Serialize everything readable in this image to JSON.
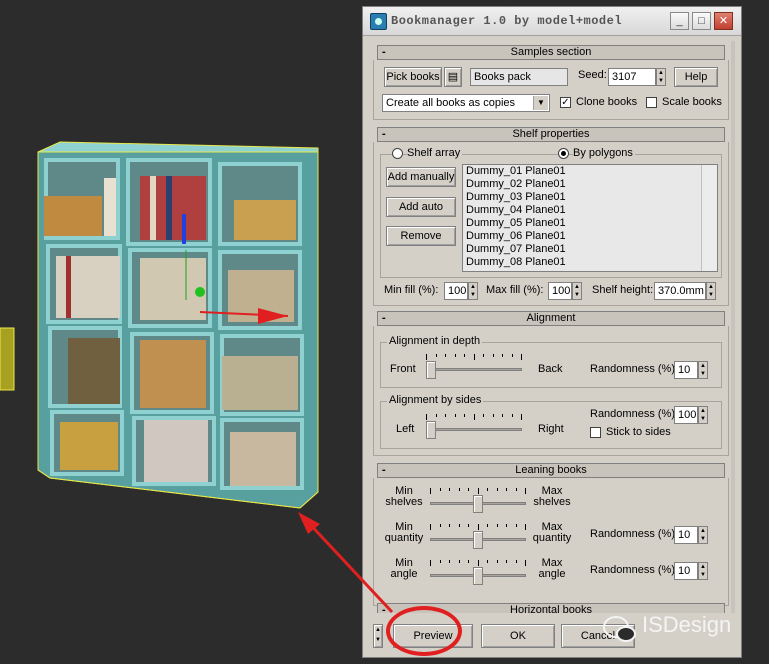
{
  "window": {
    "title": "Bookmanager 1.0 by model+model",
    "minimize_glyph": "_",
    "maximize_glyph": "□",
    "close_glyph": "✕"
  },
  "samples": {
    "header": "Samples section",
    "collapse": "-",
    "pick_books": "Pick books",
    "books_pack": "Books pack",
    "seed_label": "Seed:",
    "seed_value": "3107",
    "help": "Help",
    "mode": "Create all books as copies",
    "clone_books": "Clone books",
    "scale_books": "Scale books"
  },
  "shelf": {
    "header": "Shelf properties",
    "collapse": "-",
    "shelf_array": "Shelf array",
    "by_polygons": "By polygons",
    "add_manually": "Add manually",
    "add_auto": "Add auto",
    "remove": "Remove",
    "items": [
      "Dummy_01 Plane01",
      "Dummy_02 Plane01",
      "Dummy_03 Plane01",
      "Dummy_04 Plane01",
      "Dummy_05 Plane01",
      "Dummy_06 Plane01",
      "Dummy_07 Plane01",
      "Dummy_08 Plane01"
    ],
    "min_fill_label": "Min fill (%):",
    "min_fill_value": "100",
    "max_fill_label": "Max fill (%):",
    "max_fill_value": "100",
    "shelf_height_label": "Shelf height:",
    "shelf_height_value": "370.0mm"
  },
  "alignment": {
    "header": "Alignment",
    "collapse": "-",
    "depth_group": "Alignment in depth",
    "front": "Front",
    "back": "Back",
    "randomness_label": "Randomness (%):",
    "depth_randomness": "10",
    "sides_group": "Alignment by sides",
    "left": "Left",
    "right": "Right",
    "sides_randomness": "100",
    "stick_to_sides": "Stick to sides",
    "depth_slider_level": 0.0,
    "sides_slider_level": 0.0
  },
  "leaning": {
    "header": "Leaning books",
    "collapse": "-",
    "min_shelves": "Min shelves",
    "max_shelves": "Max shelves",
    "min_quantity": "Min quantity",
    "max_quantity": "Max quantity",
    "min_angle": "Min angle",
    "max_angle": "Max angle",
    "randomness_label": "Randomness (%):",
    "quantity_randomness": "10",
    "angle_randomness": "10",
    "shelves_level": 0.5,
    "quantity_level": 0.5,
    "angle_level": 0.5
  },
  "horizontal": {
    "header": "Horizontal books",
    "collapse": "-"
  },
  "footer": {
    "preview": "Preview",
    "ok": "OK",
    "cancel": "Cancel"
  },
  "watermark": {
    "text": "ISDesign"
  },
  "colors": {
    "annotation_red": "#e02020",
    "shelf_cyan": "#7fc8c8",
    "selection_yellow": "#e8e84a"
  }
}
